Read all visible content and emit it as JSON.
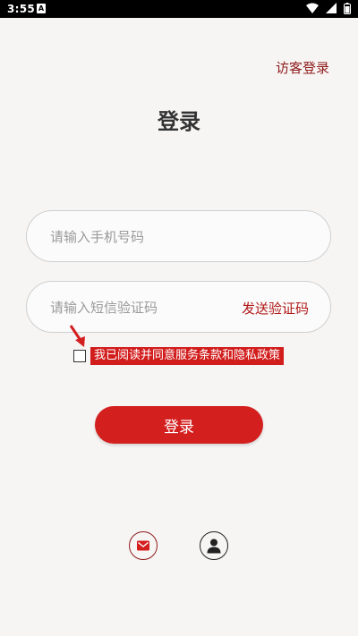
{
  "status_bar": {
    "time": "3:55",
    "notification_icon": "A"
  },
  "header": {
    "guest_login": "访客登录"
  },
  "title": "登录",
  "phone_field": {
    "placeholder": "请输入手机号码",
    "value": ""
  },
  "code_field": {
    "placeholder": "请输入短信验证码",
    "value": "",
    "send_code_label": "发送验证码"
  },
  "agreement": {
    "text": "我已阅读并同意服务条款和隐私政策",
    "checked": false
  },
  "login_button": "登录",
  "alt_login": [
    {
      "icon": "mail-icon"
    },
    {
      "icon": "user-icon"
    }
  ],
  "colors": {
    "accent": "#d41f1f",
    "dark_red": "#8e1b1b",
    "background": "#f7f5f4"
  }
}
